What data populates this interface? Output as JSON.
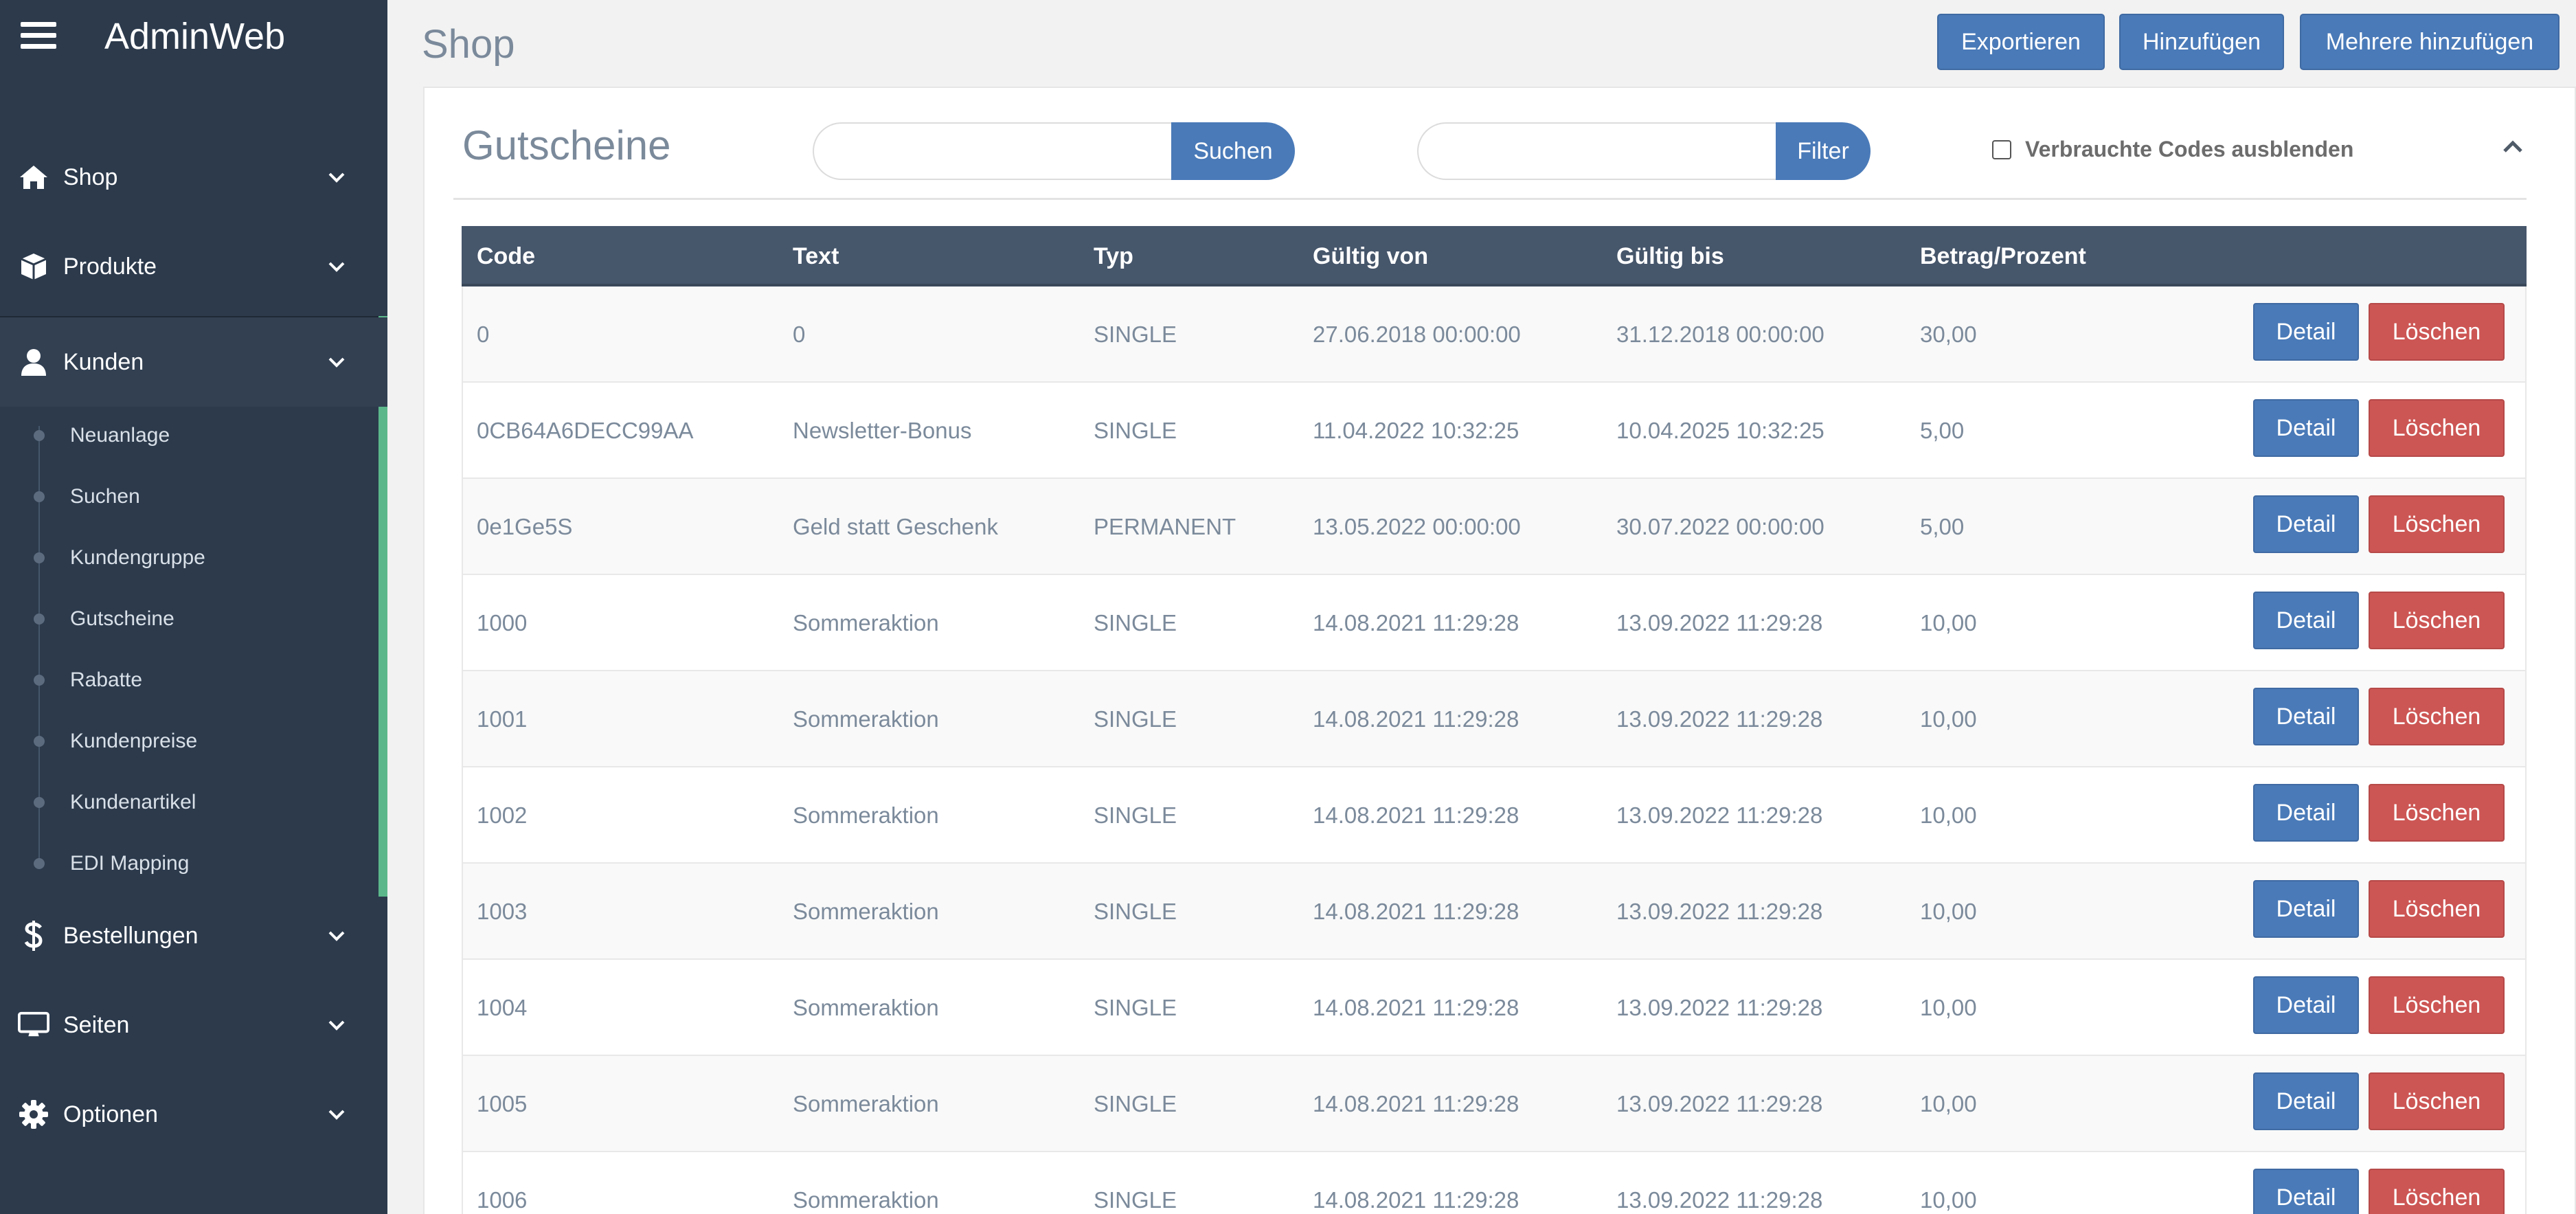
{
  "app": {
    "title": "AdminWeb"
  },
  "sidebar": {
    "items": [
      {
        "label": "Shop",
        "icon": "home-icon"
      },
      {
        "label": "Produkte",
        "icon": "cube-icon"
      },
      {
        "label": "Kunden",
        "icon": "user-icon"
      },
      {
        "label": "Bestellungen",
        "icon": "dollar-icon"
      },
      {
        "label": "Seiten",
        "icon": "monitor-icon"
      },
      {
        "label": "Optionen",
        "icon": "gear-icon"
      }
    ],
    "active_item": "Kunden",
    "subitems": [
      {
        "label": "Neuanlage"
      },
      {
        "label": "Suchen"
      },
      {
        "label": "Kundengruppe"
      },
      {
        "label": "Gutscheine"
      },
      {
        "label": "Rabatte"
      },
      {
        "label": "Kundenpreise"
      },
      {
        "label": "Kundenartikel"
      },
      {
        "label": "EDI Mapping"
      }
    ]
  },
  "header": {
    "page_title": "Shop",
    "buttons": {
      "export": "Exportieren",
      "add": "Hinzufügen",
      "add_multiple": "Mehrere hinzufügen"
    }
  },
  "card": {
    "title": "Gutscheine",
    "search": {
      "value": "",
      "placeholder": "",
      "button": "Suchen"
    },
    "filter": {
      "value": "",
      "placeholder": "",
      "button": "Filter"
    },
    "hide_used_checkbox": {
      "label": "Verbrauchte Codes ausblenden",
      "checked": false
    }
  },
  "table": {
    "columns": [
      "Code",
      "Text",
      "Typ",
      "Gültig von",
      "Gültig bis",
      "Betrag/Prozent"
    ],
    "actions": {
      "detail": "Detail",
      "delete": "Löschen"
    },
    "rows": [
      {
        "code": "0",
        "text": "0",
        "typ": "SINGLE",
        "von": "27.06.2018 00:00:00",
        "bis": "31.12.2018 00:00:00",
        "betrag": "30,00"
      },
      {
        "code": "0CB64A6DECC99AA",
        "text": "Newsletter-Bonus",
        "typ": "SINGLE",
        "von": "11.04.2022 10:32:25",
        "bis": "10.04.2025 10:32:25",
        "betrag": "5,00"
      },
      {
        "code": "0e1Ge5S",
        "text": "Geld statt Geschenk",
        "typ": "PERMANENT",
        "von": "13.05.2022 00:00:00",
        "bis": "30.07.2022 00:00:00",
        "betrag": "5,00"
      },
      {
        "code": "1000",
        "text": "Sommeraktion",
        "typ": "SINGLE",
        "von": "14.08.2021 11:29:28",
        "bis": "13.09.2022 11:29:28",
        "betrag": "10,00"
      },
      {
        "code": "1001",
        "text": "Sommeraktion",
        "typ": "SINGLE",
        "von": "14.08.2021 11:29:28",
        "bis": "13.09.2022 11:29:28",
        "betrag": "10,00"
      },
      {
        "code": "1002",
        "text": "Sommeraktion",
        "typ": "SINGLE",
        "von": "14.08.2021 11:29:28",
        "bis": "13.09.2022 11:29:28",
        "betrag": "10,00"
      },
      {
        "code": "1003",
        "text": "Sommeraktion",
        "typ": "SINGLE",
        "von": "14.08.2021 11:29:28",
        "bis": "13.09.2022 11:29:28",
        "betrag": "10,00"
      },
      {
        "code": "1004",
        "text": "Sommeraktion",
        "typ": "SINGLE",
        "von": "14.08.2021 11:29:28",
        "bis": "13.09.2022 11:29:28",
        "betrag": "10,00"
      },
      {
        "code": "1005",
        "text": "Sommeraktion",
        "typ": "SINGLE",
        "von": "14.08.2021 11:29:28",
        "bis": "13.09.2022 11:29:28",
        "betrag": "10,00"
      },
      {
        "code": "1006",
        "text": "Sommeraktion",
        "typ": "SINGLE",
        "von": "14.08.2021 11:29:28",
        "bis": "13.09.2022 11:29:28",
        "betrag": "10,00"
      }
    ]
  },
  "colors": {
    "sidebar_bg": "#2c3a4c",
    "primary": "#4a7ab8",
    "danger": "#cc5654",
    "active_indicator": "#5cb88a",
    "table_header": "#46566b"
  }
}
